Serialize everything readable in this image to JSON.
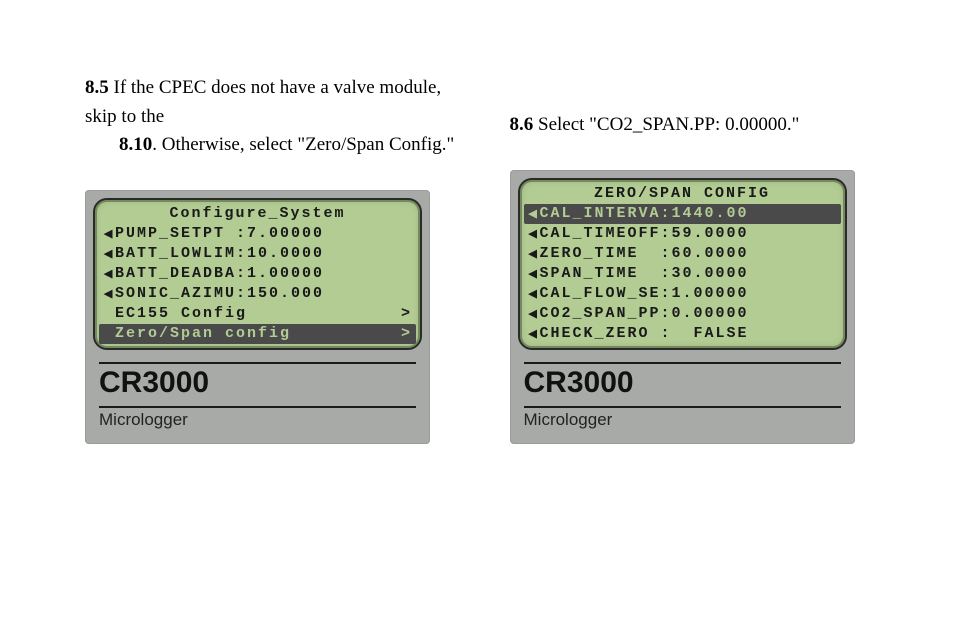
{
  "left": {
    "step_num": "8.5",
    "step_text_1": " If the CPEC does not have a valve module, skip to the ",
    "step_bold": "8.10",
    "step_text_2": ". Otherwise, select \"Zero/Span Config.\"",
    "lcd_title": "Configure_System",
    "rows": [
      {
        "arrow": "◀",
        "label": "PUMP_SETPT ",
        "sep": ":",
        "val": "7.00000",
        "gt": ""
      },
      {
        "arrow": "◀",
        "label": "BATT_LOWLIM",
        "sep": ":",
        "val": "10.0000",
        "gt": ""
      },
      {
        "arrow": "◀",
        "label": "BATT_DEADBA",
        "sep": ":",
        "val": "1.00000",
        "gt": ""
      },
      {
        "arrow": "◀",
        "label": "SONIC_AZIMU",
        "sep": ":",
        "val": "150.000",
        "gt": ""
      },
      {
        "arrow": " ",
        "label": "EC155 Config",
        "sep": "",
        "val": "",
        "gt": ">"
      },
      {
        "arrow": " ",
        "label": "Zero/Span config",
        "sep": "",
        "val": "",
        "gt": ">",
        "selected": true
      }
    ],
    "model": "CR3000",
    "sub": "Micrologger"
  },
  "right": {
    "step_num": "8.6",
    "step_text": " Select \"CO2_SPAN.PP: 0.00000.\"",
    "lcd_title": "ZERO/SPAN CONFIG",
    "rows": [
      {
        "arrow": "◀",
        "label": "CAL_INTERVA",
        "sep": ":",
        "val": "1440.00",
        "selected": true
      },
      {
        "arrow": "◀",
        "label": "CAL_TIMEOFF",
        "sep": ":",
        "val": "59.0000"
      },
      {
        "arrow": "◀",
        "label": "ZERO_TIME  ",
        "sep": ":",
        "val": "60.0000"
      },
      {
        "arrow": "◀",
        "label": "SPAN_TIME  ",
        "sep": ":",
        "val": "30.0000"
      },
      {
        "arrow": "◀",
        "label": "CAL_FLOW_SE",
        "sep": ":",
        "val": "1.00000"
      },
      {
        "arrow": "◀",
        "label": "CO2_SPAN_PP",
        "sep": ":",
        "val": "0.00000"
      },
      {
        "arrow": "◀",
        "label": "CHECK_ZERO ",
        "sep": ":",
        "val": "  FALSE"
      }
    ],
    "model": "CR3000",
    "sub": "Micrologger"
  }
}
